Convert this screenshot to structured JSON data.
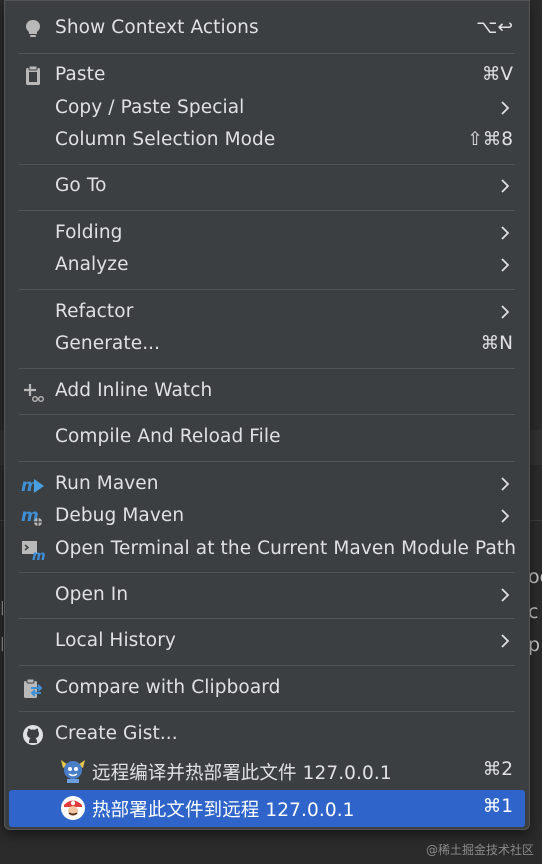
{
  "editor": {
    "edge_lines": [
      "oc",
      "c",
      "p"
    ],
    "watermark": "@稀土掘金技术社区"
  },
  "menu": {
    "items": [
      {
        "id": "show-context-actions",
        "label": "Show Context Actions",
        "shortcut": "⌥↩",
        "icon": "bulb-icon"
      },
      {
        "id": "paste",
        "label": "Paste",
        "shortcut": "⌘V",
        "icon": "clipboard-icon"
      },
      {
        "id": "copy-paste-special",
        "label": "Copy / Paste Special",
        "submenu": true
      },
      {
        "id": "column-selection-mode",
        "label": "Column Selection Mode",
        "shortcut": "⇧⌘8"
      },
      {
        "id": "go-to",
        "label": "Go To",
        "submenu": true
      },
      {
        "id": "folding",
        "label": "Folding",
        "submenu": true
      },
      {
        "id": "analyze",
        "label": "Analyze",
        "submenu": true
      },
      {
        "id": "refactor",
        "label": "Refactor",
        "submenu": true
      },
      {
        "id": "generate",
        "label": "Generate...",
        "shortcut": "⌘N"
      },
      {
        "id": "add-inline-watch",
        "label": "Add Inline Watch",
        "icon": "add-watch-icon"
      },
      {
        "id": "compile-reload",
        "label": "Compile And Reload File"
      },
      {
        "id": "run-maven",
        "label": "Run Maven",
        "submenu": true,
        "icon": "maven-run-icon"
      },
      {
        "id": "debug-maven",
        "label": "Debug Maven",
        "submenu": true,
        "icon": "maven-debug-icon"
      },
      {
        "id": "open-terminal-maven",
        "label": "Open Terminal at the Current Maven Module Path",
        "icon": "terminal-maven-icon"
      },
      {
        "id": "open-in",
        "label": "Open In",
        "submenu": true
      },
      {
        "id": "local-history",
        "label": "Local History",
        "submenu": true
      },
      {
        "id": "compare-clipboard",
        "label": "Compare with Clipboard",
        "icon": "compare-clipboard-icon"
      },
      {
        "id": "create-gist",
        "label": "Create Gist...",
        "icon": "github-icon"
      },
      {
        "id": "remote-compile-hotdeploy",
        "label": "远程编译并热部署此文件 127.0.0.1",
        "shortcut": "⌘2",
        "icon": "arthas-icon"
      },
      {
        "id": "hotdeploy-to-remote",
        "label": "热部署此文件到远程 127.0.0.1",
        "shortcut": "⌘1",
        "icon": "mario-icon",
        "selected": true
      }
    ]
  },
  "colors": {
    "menu_bg": "#3c3f41",
    "selection": "#2f65ca",
    "text": "#dfe1e5",
    "separator": "#515457"
  }
}
